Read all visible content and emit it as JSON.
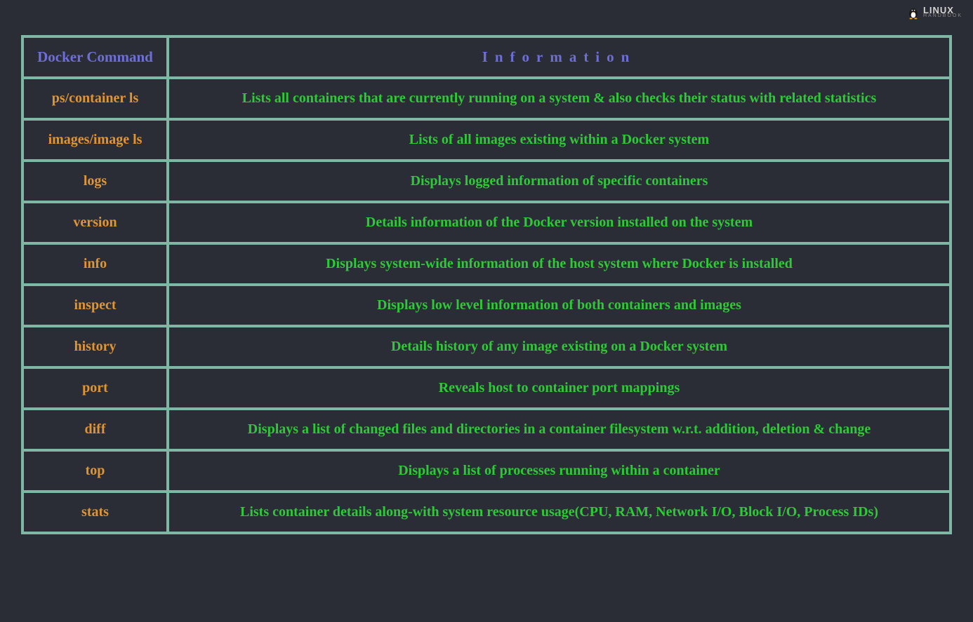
{
  "logo": {
    "main": "LINUX",
    "sub": "HANDBOOK"
  },
  "table": {
    "headers": {
      "command": "Docker Command",
      "info": "Information"
    },
    "rows": [
      {
        "command": "ps/container ls",
        "info": "Lists all containers that are currently running on a system & also checks their status with related statistics"
      },
      {
        "command": "images/image ls",
        "info": "Lists of all images existing within a Docker system"
      },
      {
        "command": "logs",
        "info": "Displays logged information of specific containers"
      },
      {
        "command": "version",
        "info": "Details information of the Docker version installed on the system"
      },
      {
        "command": "info",
        "info": "Displays system-wide information of the host system where Docker is installed"
      },
      {
        "command": "inspect",
        "info": "Displays low level information  of both containers and images"
      },
      {
        "command": "history",
        "info": "Details history of any image existing on a Docker system"
      },
      {
        "command": "port",
        "info": "Reveals host to container port mappings"
      },
      {
        "command": "diff",
        "info": "Displays a list of changed files and directories in a container filesystem w.r.t. addition, deletion & change"
      },
      {
        "command": "top",
        "info": "Displays a list of processes running within a container"
      },
      {
        "command": "stats",
        "info": "Lists container details along-with system resource usage(CPU, RAM, Network I/O, Block I/O, Process IDs)"
      }
    ]
  }
}
